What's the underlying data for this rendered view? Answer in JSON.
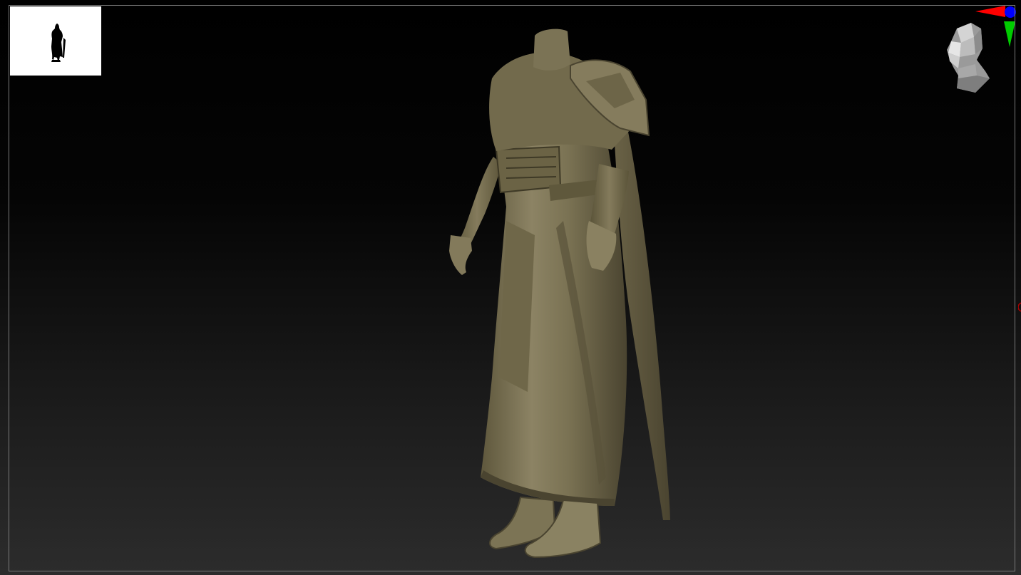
{
  "app": {
    "viewport_name": "3D viewport",
    "colors": {
      "model_base": "#6e6648",
      "model_light": "#9a9070",
      "model_shadow": "#3f3a28",
      "navigator_bg": "#ffffff",
      "axis_x": "#ff0000",
      "axis_y": "#00cc00",
      "axis_z": "#0000ff",
      "frame_border": "#7a7a7a"
    }
  },
  "navigator": {
    "icon": "figure-silhouette-icon"
  },
  "gizmo": {
    "icon": "orientation-head-icon",
    "axes": [
      "x",
      "y",
      "z"
    ]
  },
  "model": {
    "icon": "sculpted-robed-figure"
  }
}
